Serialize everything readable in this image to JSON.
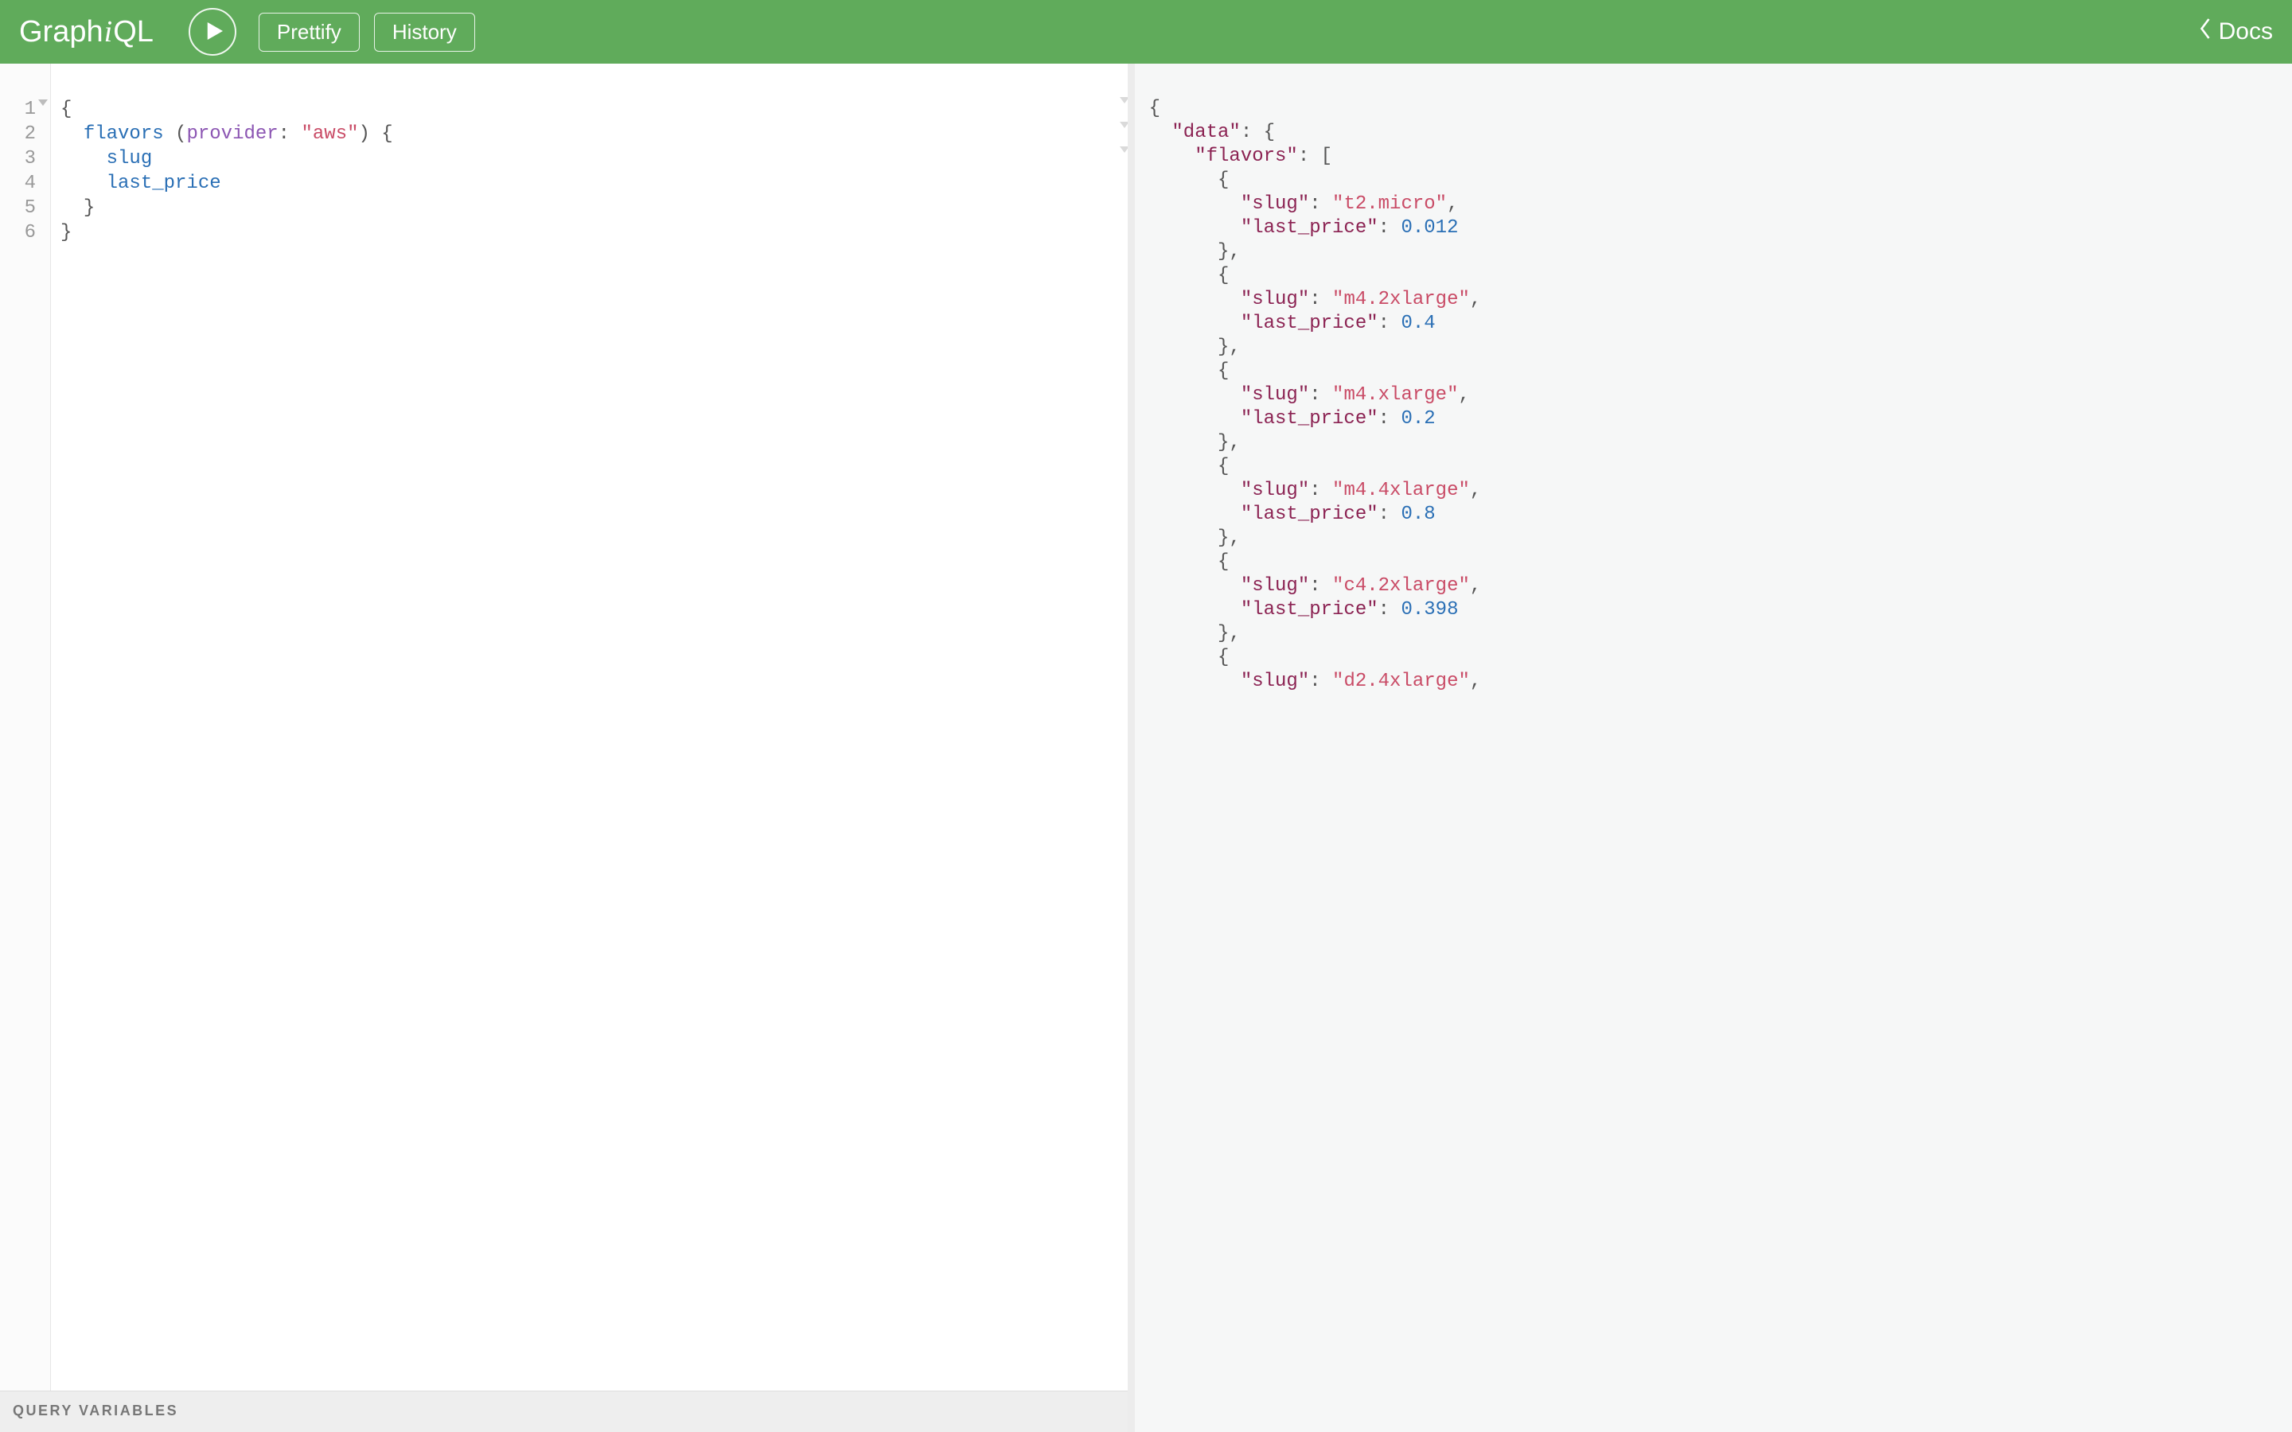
{
  "app": {
    "name_pre": "Graph",
    "name_i": "i",
    "name_post": "QL"
  },
  "toolbar": {
    "prettify_label": "Prettify",
    "history_label": "History",
    "docs_label": "Docs"
  },
  "editor": {
    "line_numbers": [
      "1",
      "2",
      "3",
      "4",
      "5",
      "6"
    ],
    "query": {
      "field": "flavors",
      "arg_name": "provider",
      "arg_value": "\"aws\"",
      "subfields": [
        "slug",
        "last_price"
      ]
    }
  },
  "vars_label": "QUERY VARIABLES",
  "result": {
    "root_key": "\"data\"",
    "list_key": "\"flavors\"",
    "item_keys": {
      "slug": "\"slug\"",
      "last_price": "\"last_price\""
    },
    "items": [
      {
        "slug": "\"t2.micro\"",
        "last_price": "0.012"
      },
      {
        "slug": "\"m4.2xlarge\"",
        "last_price": "0.4"
      },
      {
        "slug": "\"m4.xlarge\"",
        "last_price": "0.2"
      },
      {
        "slug": "\"m4.4xlarge\"",
        "last_price": "0.8"
      },
      {
        "slug": "\"c4.2xlarge\"",
        "last_price": "0.398"
      },
      {
        "slug": "\"d2.4xlarge\"",
        "last_price": ""
      }
    ]
  }
}
